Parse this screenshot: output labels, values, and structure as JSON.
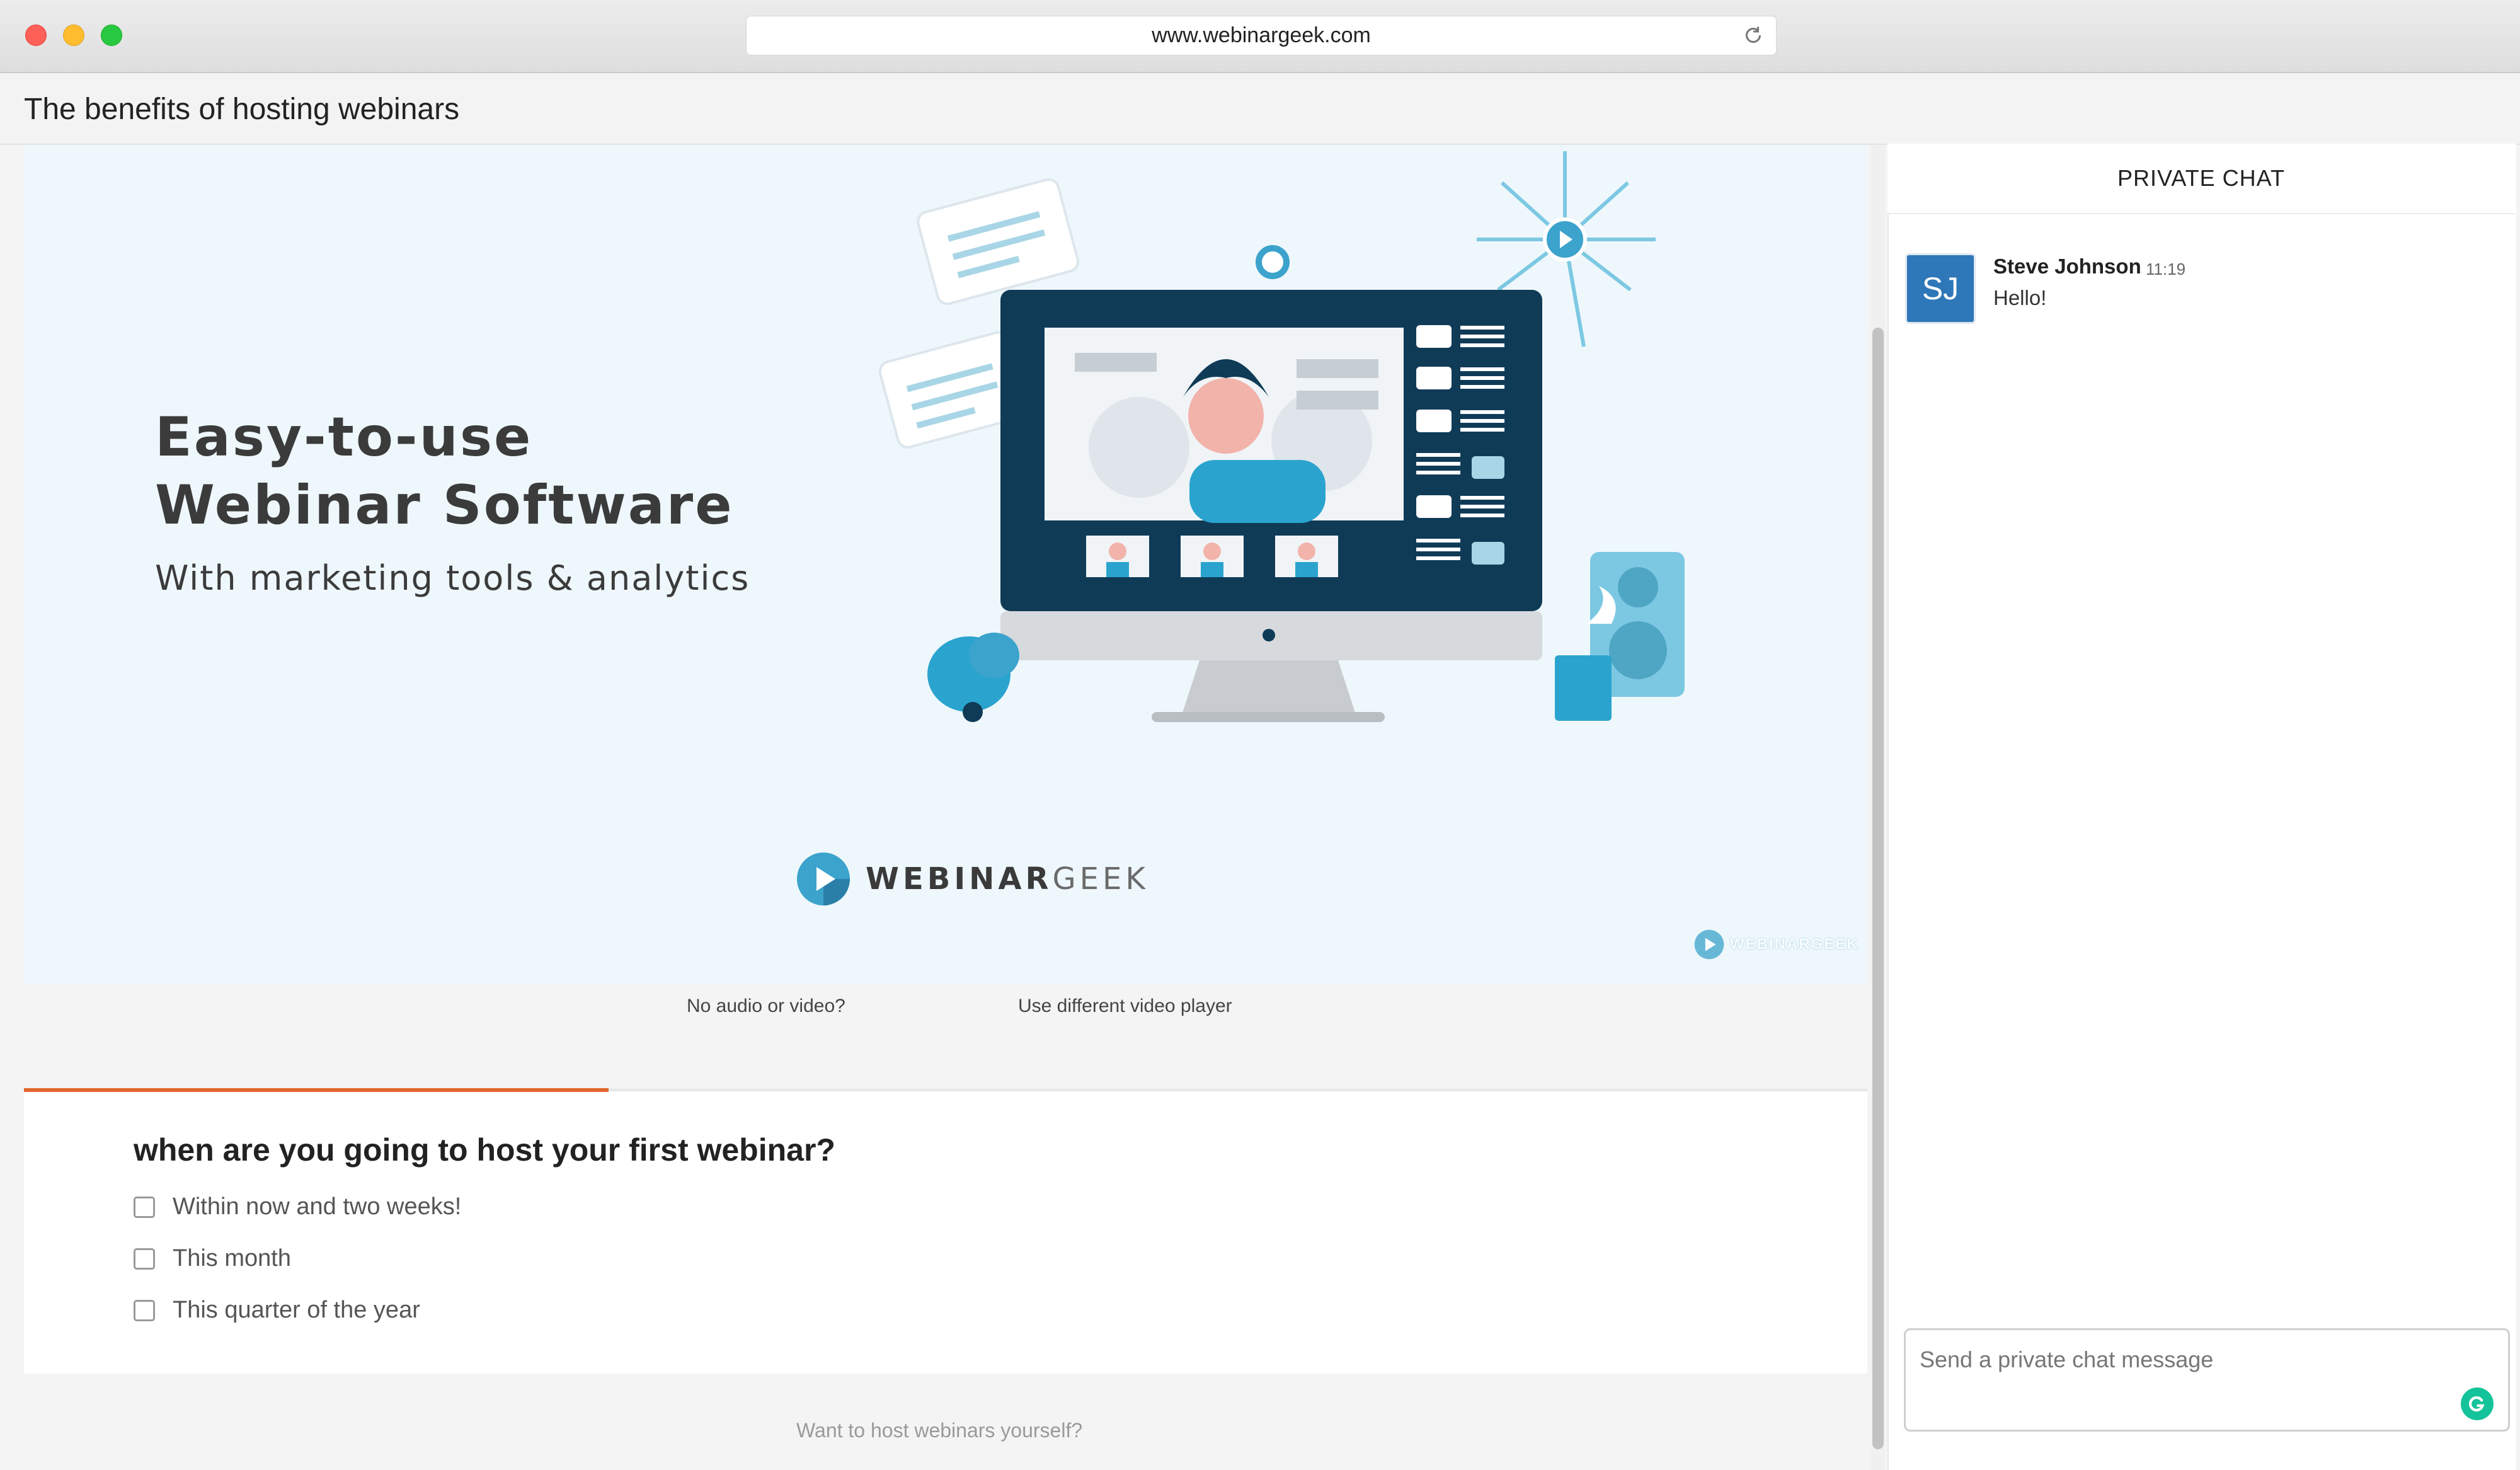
{
  "browser": {
    "url": "www.webinargeek.com"
  },
  "page": {
    "title": "The benefits of hosting webinars"
  },
  "hero": {
    "headline_line1": "Easy-to-use",
    "headline_line2": "Webinar Software",
    "subline": "With marketing tools & analytics",
    "brand_bold": "WEBINAR",
    "brand_light": "GEEK",
    "watermark": "WEBINARGEEK"
  },
  "video_links": {
    "no_audio": "No audio or video?",
    "different_player": "Use different video player"
  },
  "poll": {
    "question": "when are you going to host your first webinar?",
    "options": [
      "Within now and two weeks!",
      "This month",
      "This quarter of the year"
    ],
    "progress": 0.317
  },
  "footer": {
    "text": "Want to host webinars yourself?"
  },
  "chat": {
    "header": "PRIVATE CHAT",
    "messages": [
      {
        "initials": "SJ",
        "name": "Steve Johnson",
        "time": "11:19",
        "text": "Hello!"
      }
    ],
    "input_placeholder": "Send a private chat message"
  },
  "colors": {
    "accent": "#e2662a",
    "avatar": "#2e77b8",
    "brand_blue": "#3ba3cc",
    "grammarly": "#15c39a"
  }
}
